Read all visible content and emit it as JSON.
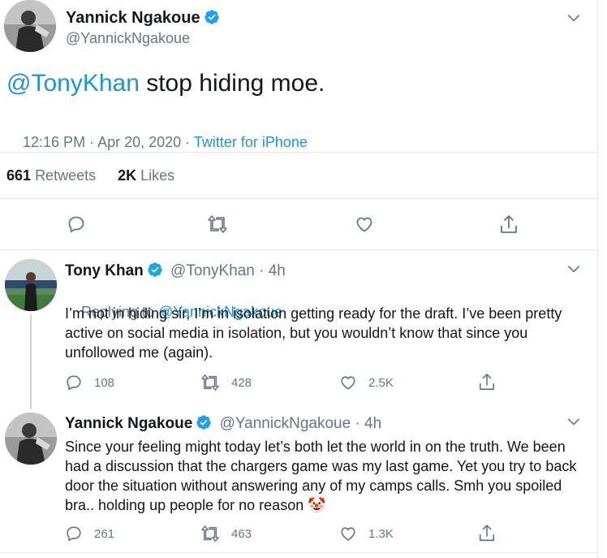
{
  "main_tweet": {
    "name": "Yannick Ngakoue",
    "handle": "@YannickNgakoue",
    "mention": "@TonyKhan",
    "text": " stop hiding moe.",
    "time": "12:16 PM · Apr 20, 2020 · ",
    "source": "Twitter for iPhone",
    "retweets_count": "661",
    "retweets_label": "Retweets",
    "likes_count": "2K",
    "likes_label": "Likes"
  },
  "reply1": {
    "name": "Tony Khan",
    "handle_time": "@TonyKhan · 4h",
    "replying_prefix": "Replying to ",
    "replying_to": "@YannickNgakoue",
    "text": "I’m not in hiding sir, I’m in isolation getting ready for the draft. I’ve been pretty active on social media in isolation, but you wouldn’t know that since you unfollowed me (again).",
    "replies": "108",
    "retweets": "428",
    "likes": "2.5K"
  },
  "reply2": {
    "name": "Yannick Ngakoue",
    "handle_time": "@YannickNgakoue · 4h",
    "text": "Since your feeling might today let’s both let the world in on the truth. We been had a discussion that the chargers game was my last game. Yet you try to back door the situation without answering any of my camps calls. Smh you spoiled bra.. holding up people for no reason ",
    "emoji": "🤡",
    "replies": "261",
    "retweets": "463",
    "likes": "1.3K"
  },
  "icons": [
    "chevron-down-icon",
    "verified-badge-icon",
    "reply-icon",
    "retweet-icon",
    "like-icon",
    "share-icon",
    "clown-emoji"
  ],
  "colors": {
    "link": "#1b95e0",
    "text": "#14171a",
    "secondary": "#657786",
    "divider": "#e6ecf0"
  }
}
